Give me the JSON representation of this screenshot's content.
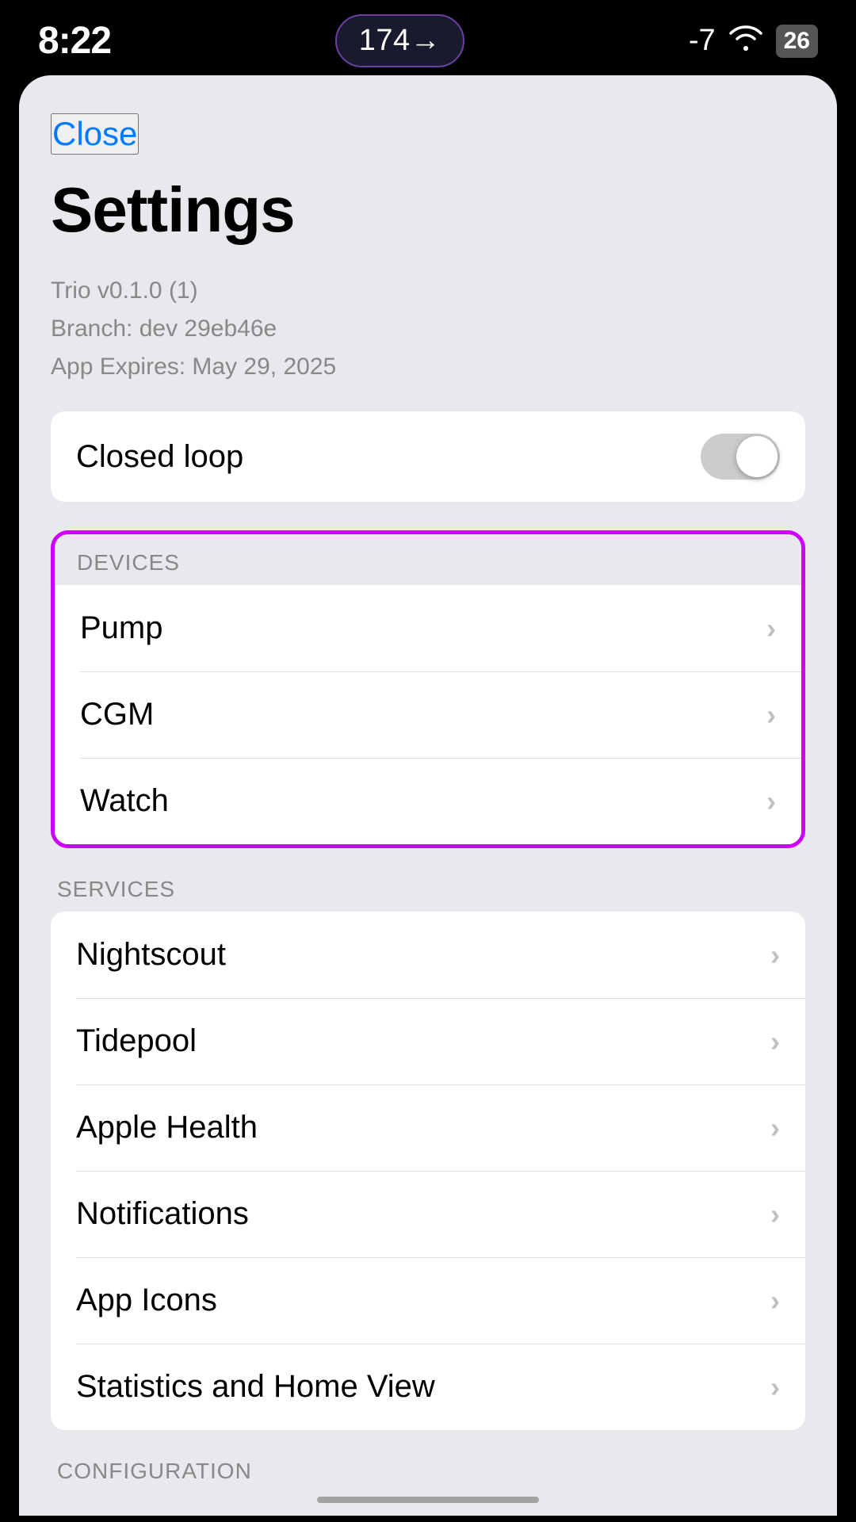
{
  "status_bar": {
    "time": "8:22",
    "pill_text": "174→",
    "negative_value": "-7",
    "battery_level": "26"
  },
  "header": {
    "close_label": "Close",
    "title": "Settings"
  },
  "app_info": {
    "version": "Trio v0.1.0 (1)",
    "branch": "Branch: dev 29eb46e",
    "expires": "App Expires: May 29, 2025"
  },
  "closed_loop": {
    "label": "Closed loop",
    "enabled": false
  },
  "devices_section": {
    "header": "DEVICES",
    "items": [
      {
        "label": "Pump"
      },
      {
        "label": "CGM"
      },
      {
        "label": "Watch"
      }
    ]
  },
  "services_section": {
    "header": "SERVICES",
    "items": [
      {
        "label": "Nightscout"
      },
      {
        "label": "Tidepool"
      },
      {
        "label": "Apple Health"
      },
      {
        "label": "Notifications"
      },
      {
        "label": "App Icons"
      },
      {
        "label": "Statistics and Home View"
      }
    ]
  },
  "configuration_section": {
    "header": "CONFIGURATION"
  },
  "icons": {
    "chevron": "›",
    "wifi": "⌤",
    "battery": "26"
  }
}
